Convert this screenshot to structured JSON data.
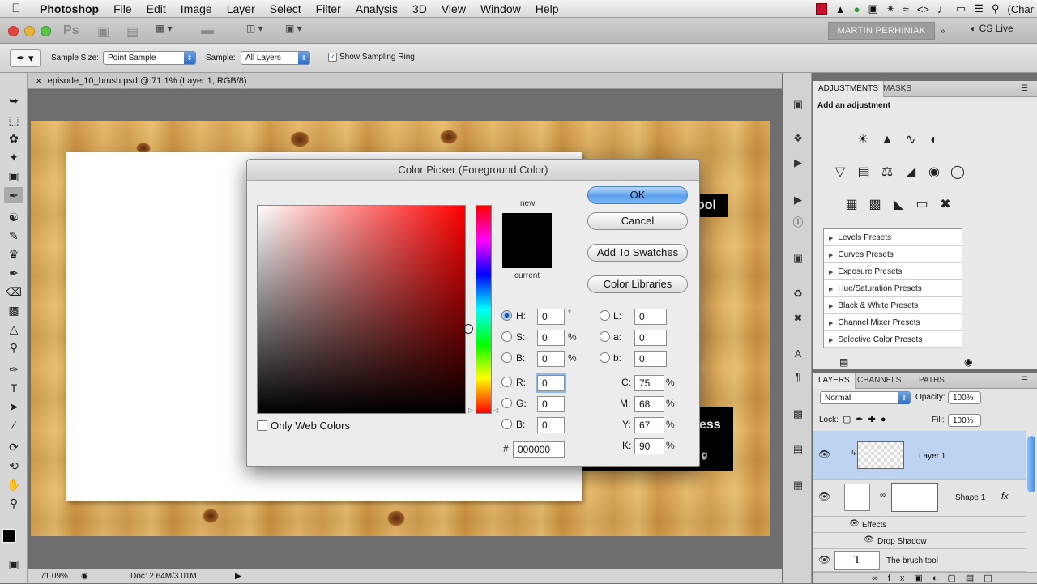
{
  "menubar": {
    "items": [
      "Photoshop",
      "File",
      "Edit",
      "Image",
      "Layer",
      "Select",
      "Filter",
      "Analysis",
      "3D",
      "View",
      "Window",
      "Help"
    ],
    "right_text": "(Char"
  },
  "appbar": {
    "ps_label": "Ps",
    "user": "MARTIN PERHINIAK",
    "cs_live": "CS Live"
  },
  "options": {
    "sample_size_label": "Sample Size:",
    "sample_size_value": "Point Sample",
    "sample_label": "Sample:",
    "sample_value": "All Layers",
    "show_ring_label": "Show Sampling Ring",
    "show_ring_checked": true
  },
  "document": {
    "tab_title": "episode_10_brush.psd @ 71.1% (Layer 1, RGB/8)",
    "canvas_text_1": "ool",
    "canvas_text_2": "ess",
    "canvas_text_3": "g"
  },
  "status": {
    "zoom": "71.09%",
    "doc": "Doc: 2.64M/3.01M"
  },
  "adjustments": {
    "tabs": [
      "ADJUSTMENTS",
      "MASKS"
    ],
    "heading": "Add an adjustment",
    "presets": [
      "Levels Presets",
      "Curves Presets",
      "Exposure Presets",
      "Hue/Saturation Presets",
      "Black & White Presets",
      "Channel Mixer Presets",
      "Selective Color Presets"
    ]
  },
  "layers": {
    "tabs": [
      "LAYERS",
      "CHANNELS",
      "PATHS"
    ],
    "blend_mode": "Normal",
    "opacity_label": "Opacity:",
    "opacity": "100%",
    "lock_label": "Lock:",
    "fill_label": "Fill:",
    "fill": "100%",
    "rows": {
      "layer1": "Layer 1",
      "shape1": "Shape 1",
      "effects": "Effects",
      "drop_shadow": "Drop Shadow",
      "text_layer": "The brush tool"
    }
  },
  "color_picker": {
    "title": "Color Picker (Foreground Color)",
    "new_label": "new",
    "current_label": "current",
    "buttons": {
      "ok": "OK",
      "cancel": "Cancel",
      "add_swatches": "Add To Swatches",
      "color_libraries": "Color Libraries"
    },
    "only_web_colors": "Only Web Colors",
    "fields": {
      "h": {
        "label": "H:",
        "value": "0",
        "unit": "°"
      },
      "s": {
        "label": "S:",
        "value": "0",
        "unit": "%"
      },
      "b": {
        "label": "B:",
        "value": "0",
        "unit": "%"
      },
      "r": {
        "label": "R:",
        "value": "0"
      },
      "g": {
        "label": "G:",
        "value": "0"
      },
      "b2": {
        "label": "B:",
        "value": "0"
      },
      "l": {
        "label": "L:",
        "value": "0"
      },
      "a": {
        "label": "a:",
        "value": "0"
      },
      "lab_b": {
        "label": "b:",
        "value": "0"
      },
      "c": {
        "label": "C:",
        "value": "75",
        "unit": "%"
      },
      "m": {
        "label": "M:",
        "value": "68",
        "unit": "%"
      },
      "y": {
        "label": "Y:",
        "value": "67",
        "unit": "%"
      },
      "k": {
        "label": "K:",
        "value": "90",
        "unit": "%"
      },
      "hex": {
        "label": "#",
        "value": "000000"
      }
    },
    "new_color": "#000000",
    "current_color": "#000000"
  }
}
